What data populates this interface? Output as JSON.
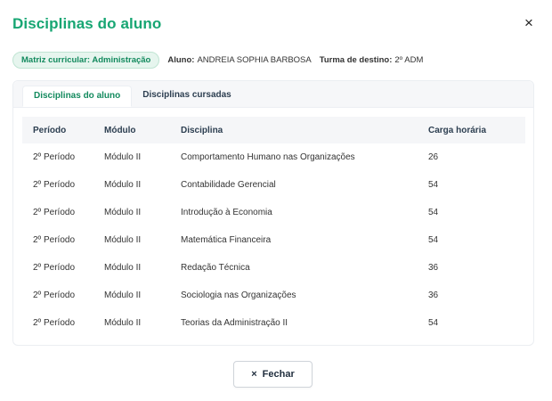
{
  "modal": {
    "title": "Disciplinas do aluno",
    "close_icon": "×"
  },
  "info": {
    "badge": "Matriz curricular: Administração",
    "aluno_label": "Aluno:",
    "aluno_value": "ANDREIA SOPHIA BARBOSA",
    "turma_label": "Turma de destino:",
    "turma_value": "2º ADM"
  },
  "tabs": [
    {
      "label": "Disciplinas do aluno",
      "active": true
    },
    {
      "label": "Disciplinas cursadas",
      "active": false
    }
  ],
  "table": {
    "headers": [
      "Período",
      "Módulo",
      "Disciplina",
      "Carga horária"
    ],
    "rows": [
      [
        "2º Período",
        "Módulo II",
        "Comportamento Humano nas Organizações",
        "26"
      ],
      [
        "2º Período",
        "Módulo II",
        "Contabilidade Gerencial",
        "54"
      ],
      [
        "2º Período",
        "Módulo II",
        "Introdução à Economia",
        "54"
      ],
      [
        "2º Período",
        "Módulo II",
        "Matemática Financeira",
        "54"
      ],
      [
        "2º Período",
        "Módulo II",
        "Redação Técnica",
        "36"
      ],
      [
        "2º Período",
        "Módulo II",
        "Sociologia nas Organizações",
        "36"
      ],
      [
        "2º Período",
        "Módulo II",
        "Teorias da Administração II",
        "54"
      ]
    ]
  },
  "footer": {
    "fechar_icon": "×",
    "fechar_label": "Fechar"
  },
  "colors": {
    "accent": "#17a673",
    "badge_bg": "#e6f5ee"
  }
}
